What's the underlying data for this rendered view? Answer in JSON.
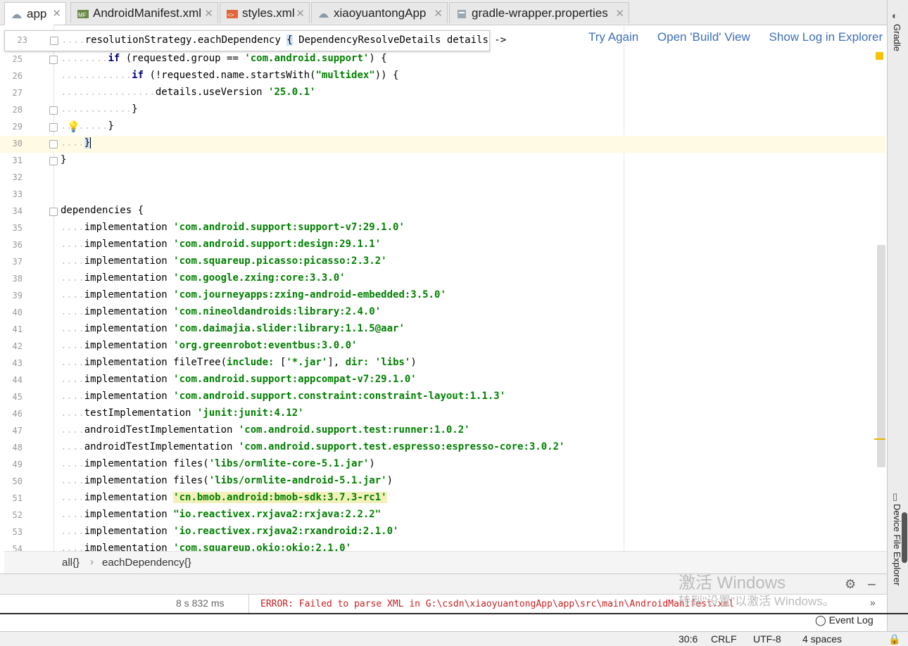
{
  "tabs": [
    {
      "label": "app",
      "active": true
    },
    {
      "label": "AndroidManifest.xml",
      "active": false
    },
    {
      "label": "styles.xml",
      "active": false
    },
    {
      "label": "xiaoyuantongApp",
      "active": false
    },
    {
      "label": "gradle-wrapper.properties",
      "active": false
    }
  ],
  "right_panel": {
    "gradle": "Gradle",
    "device_explorer": "Device File Explorer"
  },
  "popup": {
    "line_no": "23",
    "code": "resolutionStrategy.eachDependency { DependencyResolveDetails details ->"
  },
  "build_actions": {
    "try_again": "Try Again",
    "open_build": "Open 'Build' View",
    "show_log": "Show Log in Explorer"
  },
  "lines": [
    {
      "no": "25",
      "text": "if (requested.group == 'com.android.support') {"
    },
    {
      "no": "26",
      "text": "if (!requested.name.startsWith(\"multidex\")) {"
    },
    {
      "no": "27",
      "text": "details.useVersion '25.0.1'"
    },
    {
      "no": "28",
      "text": "}"
    },
    {
      "no": "29",
      "text": "}"
    },
    {
      "no": "30",
      "text": "}"
    },
    {
      "no": "31",
      "text": "}"
    },
    {
      "no": "32",
      "text": ""
    },
    {
      "no": "33",
      "text": ""
    },
    {
      "no": "34",
      "text": "dependencies {"
    },
    {
      "no": "35",
      "text": "implementation 'com.android.support:support-v7:29.1.0'"
    },
    {
      "no": "36",
      "text": "implementation 'com.android.support:design:29.1.1'"
    },
    {
      "no": "37",
      "text": "implementation 'com.squareup.picasso:picasso:2.3.2'"
    },
    {
      "no": "38",
      "text": "implementation 'com.google.zxing:core:3.3.0'"
    },
    {
      "no": "39",
      "text": "implementation 'com.journeyapps:zxing-android-embedded:3.5.0'"
    },
    {
      "no": "40",
      "text": "implementation 'com.nineoldandroids:library:2.4.0'"
    },
    {
      "no": "41",
      "text": "implementation 'com.daimajia.slider:library:1.1.5@aar'"
    },
    {
      "no": "42",
      "text": "implementation 'org.greenrobot:eventbus:3.0.0'"
    },
    {
      "no": "43",
      "text": "implementation fileTree(include: ['*.jar'], dir: 'libs')"
    },
    {
      "no": "44",
      "text": "implementation 'com.android.support:appcompat-v7:29.1.0'"
    },
    {
      "no": "45",
      "text": "implementation 'com.android.support.constraint:constraint-layout:1.1.3'"
    },
    {
      "no": "46",
      "text": "testImplementation 'junit:junit:4.12'"
    },
    {
      "no": "47",
      "text": "androidTestImplementation 'com.android.support.test:runner:1.0.2'"
    },
    {
      "no": "48",
      "text": "androidTestImplementation 'com.android.support.test.espresso:espresso-core:3.0.2'"
    },
    {
      "no": "49",
      "text": "implementation files('libs/ormlite-core-5.1.jar')"
    },
    {
      "no": "50",
      "text": "implementation files('libs/ormlite-android-5.1.jar')"
    },
    {
      "no": "51",
      "text": "implementation 'cn.bmob.android:bmob-sdk:3.7.3-rc1'"
    },
    {
      "no": "52",
      "text": "implementation \"io.reactivex.rxjava2:rxjava:2.2.2\""
    },
    {
      "no": "53",
      "text": "implementation 'io.reactivex.rxjava2:rxandroid:2.1.0'"
    },
    {
      "no": "54",
      "text": "implementation 'com.squareup.okio:okio:2.1.0'"
    }
  ],
  "breadcrumb": {
    "first": "all{}",
    "second": "eachDependency{}"
  },
  "build": {
    "time": "8 s 832 ms",
    "error": "ERROR: Failed to parse XML in G:\\csdn\\xiaoyuantongApp\\app\\src\\main\\AndroidManifest.xml"
  },
  "watermark": {
    "line1": "激活 Windows",
    "line2": "转到\"设置\"以激活 Windows。"
  },
  "status": {
    "event_log": "Event Log",
    "position": "30:6",
    "line_sep": "CRLF",
    "encoding": "UTF-8",
    "indent": "4 spaces"
  }
}
